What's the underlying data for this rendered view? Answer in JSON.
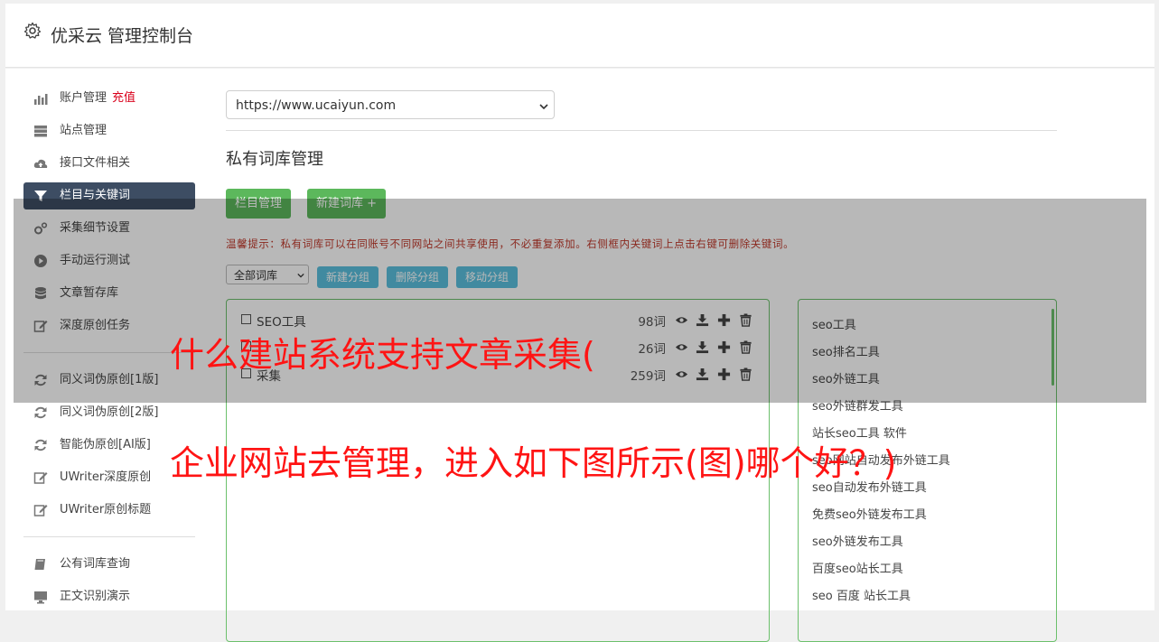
{
  "header": {
    "title": "优采云 管理控制台",
    "icon": "gear-icon"
  },
  "sidebar": {
    "items": [
      {
        "label": "账户管理",
        "badge": "充值",
        "icon": "bar-chart-icon"
      },
      {
        "label": "站点管理",
        "icon": "server-icon"
      },
      {
        "label": "接口文件相关",
        "icon": "cloud-upload-icon"
      },
      {
        "label": "栏目与关键词",
        "icon": "filter-icon",
        "active": true
      },
      {
        "label": "采集细节设置",
        "icon": "cogs-icon"
      },
      {
        "label": "手动运行测试",
        "icon": "play-circle-icon"
      },
      {
        "label": "文章暂存库",
        "icon": "database-icon"
      },
      {
        "label": "深度原创任务",
        "icon": "edit-icon"
      }
    ],
    "items2": [
      {
        "label": "同义词伪原创[1版]",
        "icon": "refresh-icon"
      },
      {
        "label": "同义词伪原创[2版]",
        "icon": "refresh-icon"
      },
      {
        "label": "智能伪原创[AI版]",
        "icon": "refresh-icon"
      },
      {
        "label": "UWriter深度原创",
        "icon": "edit-icon"
      },
      {
        "label": "UWriter原创标题",
        "icon": "edit-icon"
      }
    ],
    "items3": [
      {
        "label": "公有词库查询",
        "icon": "book-icon"
      },
      {
        "label": "正文识别演示",
        "icon": "monitor-icon"
      }
    ]
  },
  "main": {
    "site_select": "https://www.ucaiyun.com",
    "section_title": "私有词库管理",
    "btn_category": "栏目管理",
    "btn_new_lib": "新建词库 +",
    "tip": "温馨提示：私有词库可以在同账号不同网站之间共享使用，不必重复添加。右侧框内关键词上点击右键可删除关键词。",
    "group_select": "全部词库",
    "btn_new_group": "新建分组",
    "btn_delete_group": "删除分组",
    "btn_move_group": "移动分组",
    "libraries": [
      {
        "name": "SEO工具",
        "count": "98词"
      },
      {
        "name": "",
        "count": "26词"
      },
      {
        "name": "采集",
        "count": "259词"
      }
    ],
    "keywords": [
      "seo工具",
      "seo排名工具",
      "seo外链工具",
      "seo外链群发工具",
      "站长seo工具 软件",
      "seo网站自动发布外链工具",
      "seo自动发布外链工具",
      "免费seo外链发布工具",
      "seo外链发布工具",
      "百度seo站长工具",
      "seo 百度 站长工具"
    ]
  },
  "overlay": {
    "line1": "什么建站系统支持文章采集(",
    "line2": "企业网站去管理，进入如下图所示(图)哪个好？)"
  },
  "colors": {
    "green": "#5cb85c",
    "blue": "#5bc0de",
    "active_nav": "#3d4d63",
    "overlay_text": "#ff1414"
  }
}
